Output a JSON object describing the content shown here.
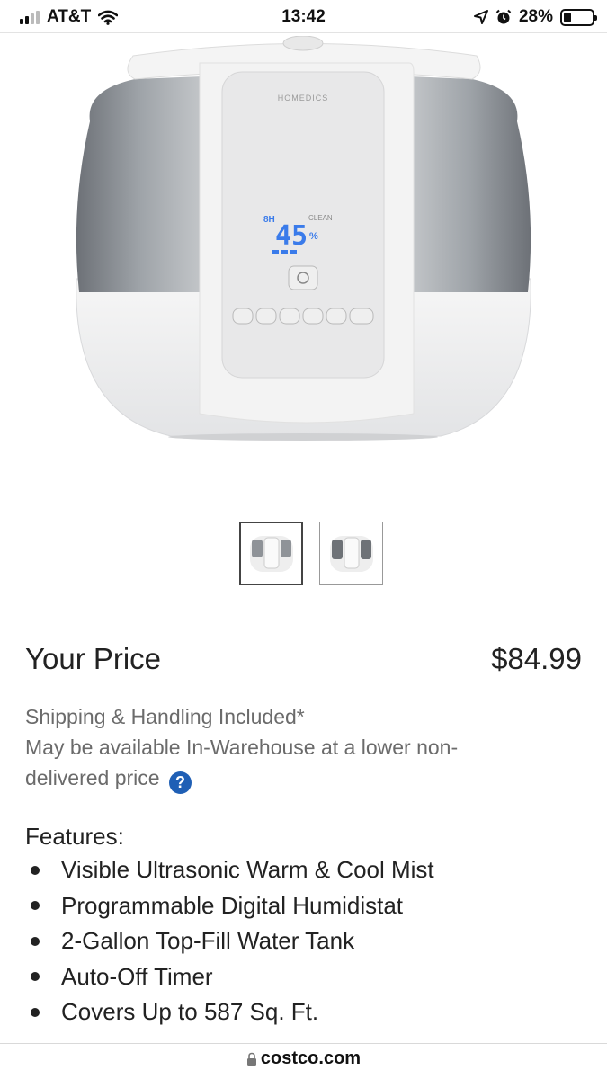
{
  "status_bar": {
    "carrier": "AT&T",
    "time": "13:42",
    "battery": "28%",
    "battery_level": 0.28,
    "icons": [
      "signal-icon",
      "wifi-icon",
      "location-icon",
      "alarm-icon",
      "battery-icon"
    ]
  },
  "product": {
    "image_icon": "humidifier-image",
    "brand_on_device": "HOMEDICS",
    "display_humidity": "45",
    "display_unit": "%",
    "display_hours": "8H",
    "display_mode": "CLEAN",
    "thumbnails": [
      "thumbnail-1",
      "thumbnail-2"
    ]
  },
  "price": {
    "label": "Your Price",
    "value": "$84.99"
  },
  "shipping": {
    "line1": "Shipping & Handling Included*",
    "line2": "May be available In-Warehouse at a lower non-delivered price"
  },
  "features": {
    "title": "Features:",
    "items": [
      "Visible Ultrasonic Warm & Cool Mist",
      "Programmable Digital Humidistat",
      "2-Gallon Top-Fill Water Tank",
      "Auto-Off Timer",
      "Covers Up to 587 Sq. Ft."
    ]
  },
  "browser": {
    "url": "costco.com"
  },
  "colors": {
    "accent_blue": "#1f5fb5",
    "muted_text": "#6b6b6b",
    "lcd_blue": "#3a7bea"
  }
}
